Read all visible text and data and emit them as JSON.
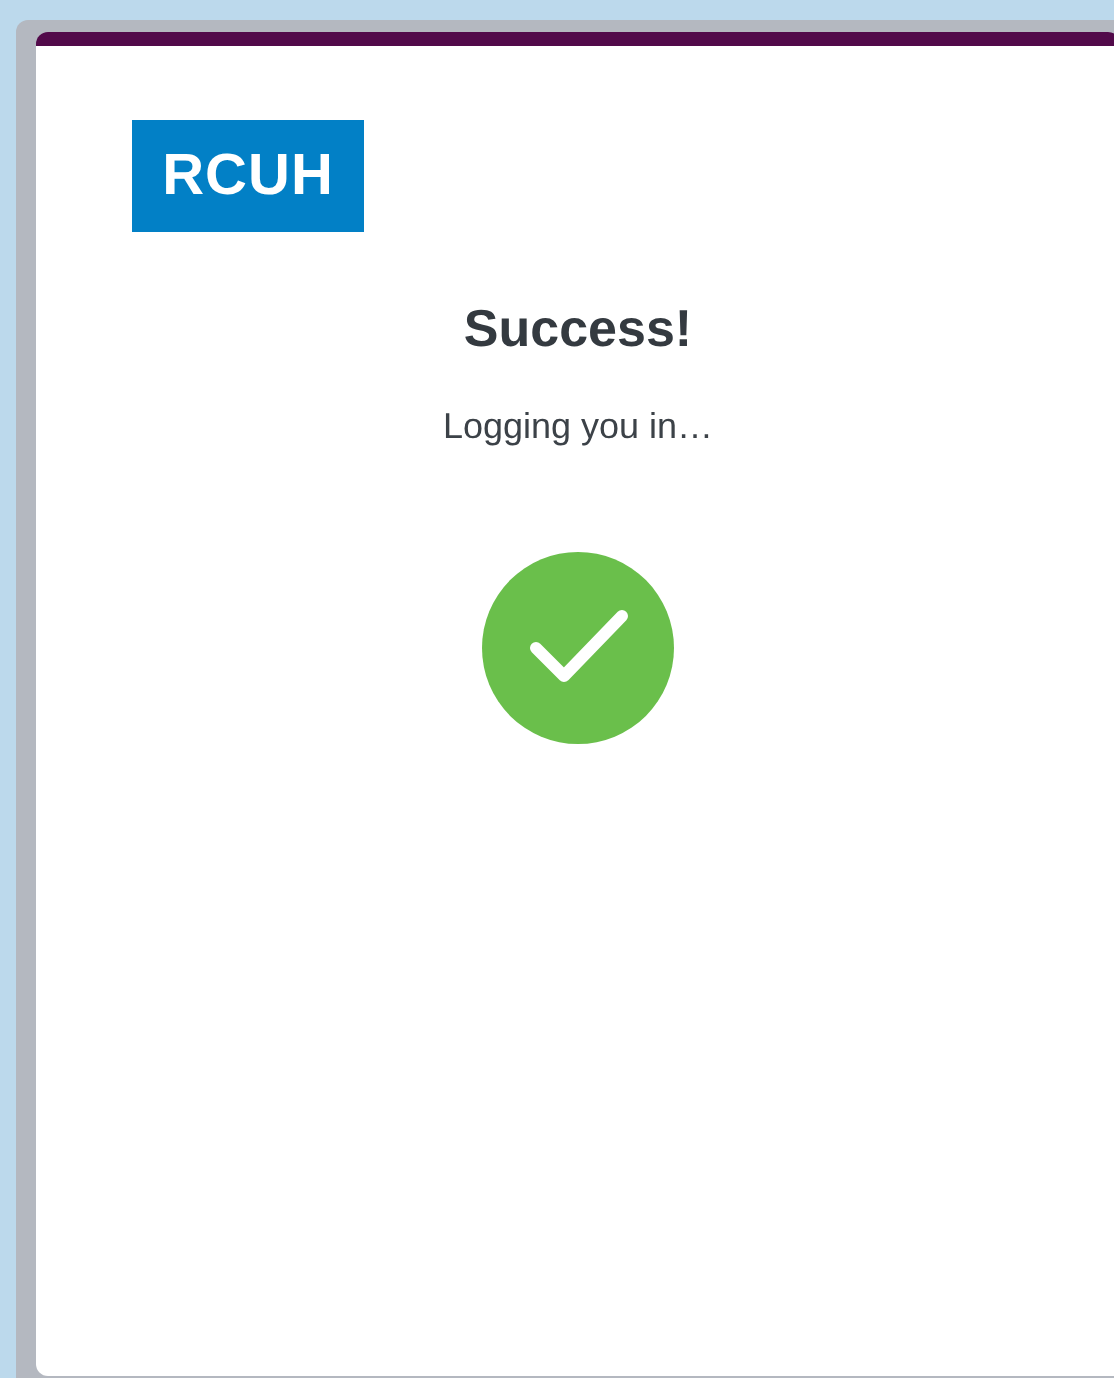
{
  "logo": {
    "text": "RCUH"
  },
  "title": "Success!",
  "message": "Logging you in…",
  "status": {
    "kind": "success"
  }
}
